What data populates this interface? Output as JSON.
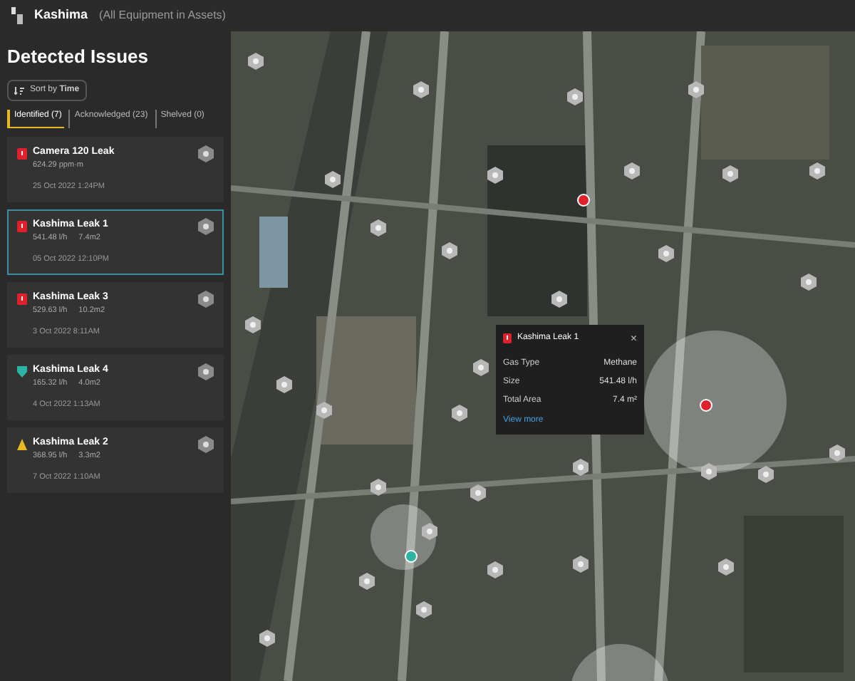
{
  "header": {
    "title": "Kashima",
    "scope": "(All Equipment in Assets)"
  },
  "panel": {
    "title": "Detected Issues",
    "sort": {
      "label": "Sort by **Time**"
    },
    "tabs": [
      {
        "label": "Identified (7)",
        "selected": true
      },
      {
        "label": "Acknowledged (23)",
        "selected": false
      },
      {
        "label": "Shelved (0)",
        "selected": false
      }
    ],
    "issues": [
      {
        "name": "Camera 120 Leak",
        "kind": "high",
        "readings": [
          "624.29 ppm·m"
        ],
        "time": "25 Oct 2022 1:24PM",
        "selected": false
      },
      {
        "name": "Kashima Leak 1",
        "kind": "high",
        "readings": [
          "541.48 l/h",
          "7.4m2"
        ],
        "time": "05 Oct 2022 12:10PM",
        "selected": true
      },
      {
        "name": "Kashima Leak 3",
        "kind": "high",
        "readings": [
          "529.63 l/h",
          "10.2m2"
        ],
        "time": "3 Oct 2022 8:11AM",
        "selected": false
      },
      {
        "name": "Kashima Leak 4",
        "kind": "low",
        "readings": [
          "165.32 l/h",
          "4.0m2"
        ],
        "time": "4 Oct 2022 1:13AM",
        "selected": false
      },
      {
        "name": "Kashima Leak 2",
        "kind": "medium",
        "readings": [
          "368.95 l/h",
          "3.3m2"
        ],
        "time": "7 Oct 2022 1:10AM",
        "selected": false
      }
    ]
  },
  "popup": {
    "title": "Kashima Leak 1",
    "close": "×",
    "rows": [
      {
        "label": "Gas Type",
        "value": "Methane"
      },
      {
        "label": "Size",
        "value": "541.48 l/h"
      },
      {
        "label": "Total Area",
        "value": "7.4 m²"
      }
    ],
    "link": "View more"
  }
}
